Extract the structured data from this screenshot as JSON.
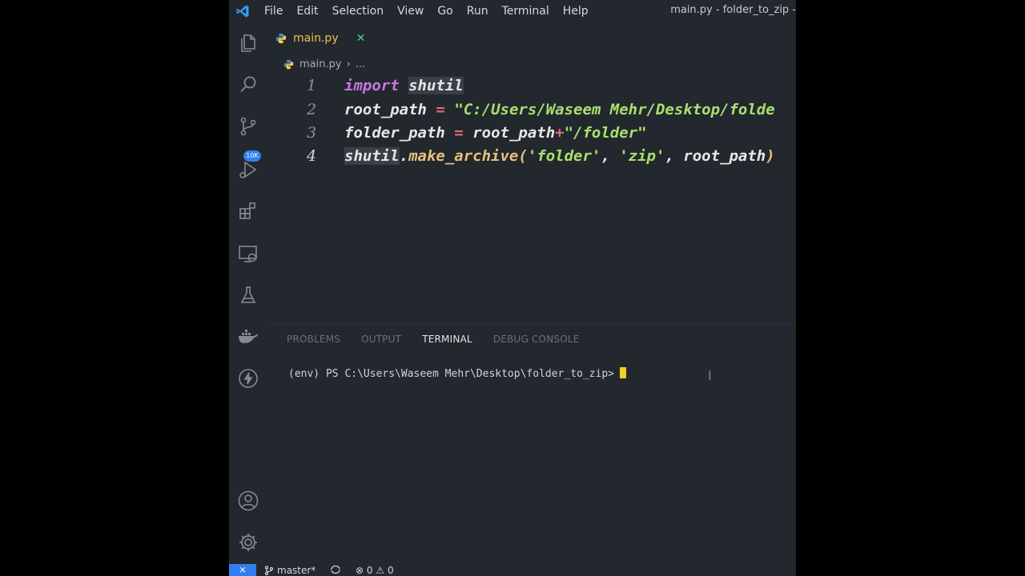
{
  "menu": {
    "items": [
      "File",
      "Edit",
      "Selection",
      "View",
      "Go",
      "Run",
      "Terminal",
      "Help"
    ]
  },
  "window": {
    "title": "main.py - folder_to_zip -"
  },
  "activity_bar": {
    "icons": [
      "files-icon",
      "search-icon",
      "source-control-icon",
      "run-debug-icon",
      "extensions-icon",
      "remote-explorer-icon",
      "testing-icon",
      "docker-icon",
      "lightning-icon",
      "account-icon",
      "gear-icon"
    ],
    "source_control_badge": "10K"
  },
  "tab": {
    "label": "main.py",
    "close": "✕"
  },
  "breadcrumb": {
    "file": "main.py",
    "rest": "..."
  },
  "editor": {
    "lines": [
      {
        "number": "1",
        "text": "import shutil"
      },
      {
        "number": "2",
        "text": "root_path = \"C:/Users/Waseem Mehr/Desktop/folde"
      },
      {
        "number": "3",
        "text": "folder_path = root_path+\"/folder\""
      },
      {
        "number": "4",
        "text": "shutil.make_archive('folder', 'zip', root_path)"
      }
    ],
    "tokens": {
      "l1_kw": "import",
      "l1_mod": "shutil",
      "l2_var": "root_path",
      "l2_eq": "=",
      "l2_str": "\"C:/Users/Waseem Mehr/Desktop/folde",
      "l3_var": "folder_path",
      "l3_eq": "=",
      "l3_ref": "root_path",
      "l3_plus": "+",
      "l3_str": "\"/folder\"",
      "l4_mod": "shutil",
      "l4_dot": ".",
      "l4_fn": "make_archive(",
      "l4_s1": "'folder'",
      "l4_c1": ", ",
      "l4_s2": "'zip'",
      "l4_c2": ", root_path",
      "l4_close": ")"
    }
  },
  "panel": {
    "tabs": [
      "PROBLEMS",
      "OUTPUT",
      "TERMINAL",
      "DEBUG CONSOLE"
    ],
    "active_tab": "TERMINAL",
    "terminal_prompt": "(env) PS C:\\Users\\Waseem Mehr\\Desktop\\folder_to_zip>"
  },
  "status_bar": {
    "remote": "⨯",
    "branch": "master*",
    "errors": "0",
    "warnings": "0"
  },
  "colors": {
    "background": "#23272e",
    "accent": "#2f7ff0",
    "keyword": "#c678dd",
    "string": "#a8e06c",
    "operator": "#e06c75",
    "function": "#e5c07b",
    "cursor": "#f0d12a"
  }
}
